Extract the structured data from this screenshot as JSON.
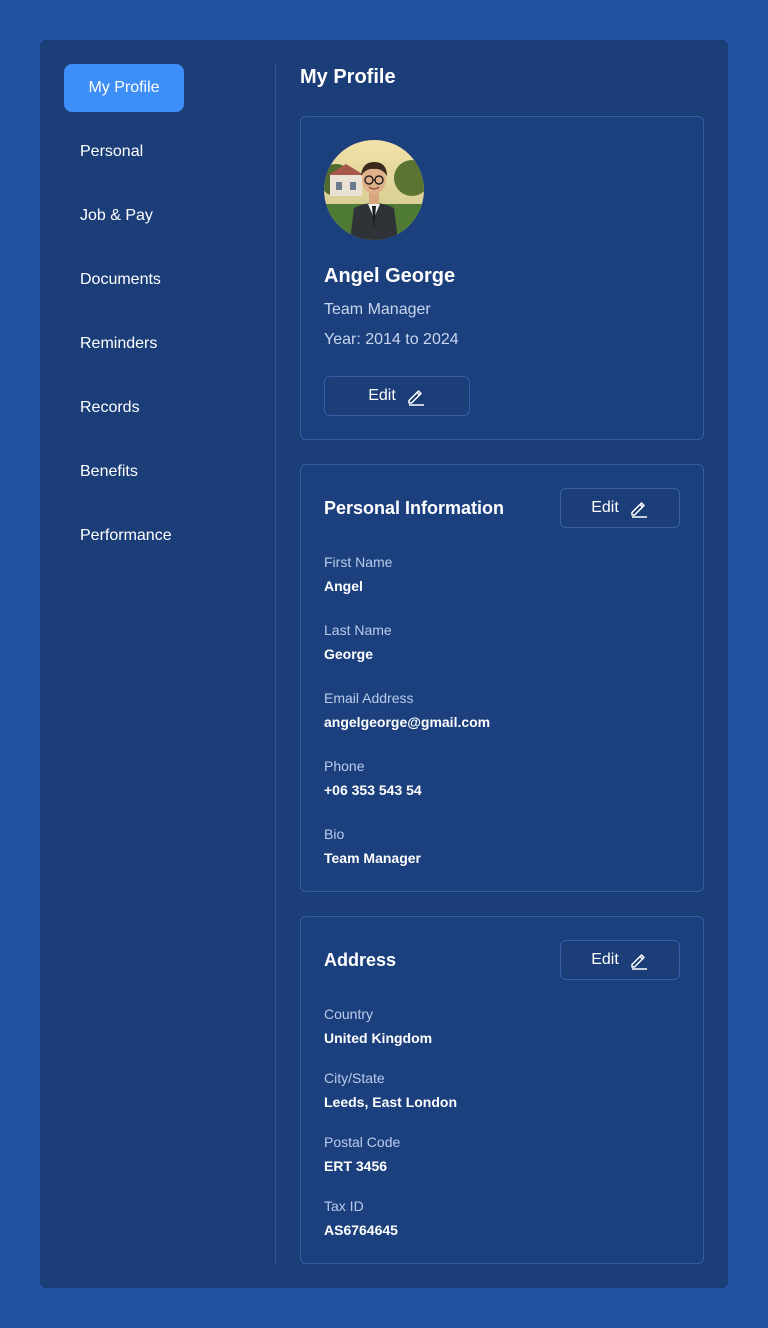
{
  "sidebar": {
    "items": [
      {
        "label": "My Profile",
        "active": true
      },
      {
        "label": "Personal"
      },
      {
        "label": "Job & Pay"
      },
      {
        "label": "Documents"
      },
      {
        "label": "Reminders"
      },
      {
        "label": "Records"
      },
      {
        "label": "Benefits"
      },
      {
        "label": "Performance"
      }
    ]
  },
  "main": {
    "title": "My Profile",
    "profile": {
      "name": "Angel George",
      "role": "Team Manager",
      "years": "Year: 2014 to 2024",
      "edit_label": "Edit",
      "avatar_icon": "profile-photo"
    },
    "personal": {
      "title": "Personal Information",
      "edit_label": "Edit",
      "fields": [
        {
          "label": "First Name",
          "value": "Angel"
        },
        {
          "label": "Last Name",
          "value": "George"
        },
        {
          "label": "Email Address",
          "value": "angelgeorge@gmail.com"
        },
        {
          "label": "Phone",
          "value": "+06 353 543 54"
        },
        {
          "label": "Bio",
          "value": "Team Manager"
        }
      ]
    },
    "address": {
      "title": "Address",
      "edit_label": "Edit",
      "fields": [
        {
          "label": "Country",
          "value": "United Kingdom"
        },
        {
          "label": "City/State",
          "value": "Leeds, East London"
        },
        {
          "label": "Postal Code",
          "value": "ERT 3456"
        },
        {
          "label": "Tax ID",
          "value": "AS6764645"
        }
      ]
    }
  },
  "colors": {
    "background": "#2353a0",
    "panel": "#1b3d78",
    "accent": "#3e8ef7"
  }
}
